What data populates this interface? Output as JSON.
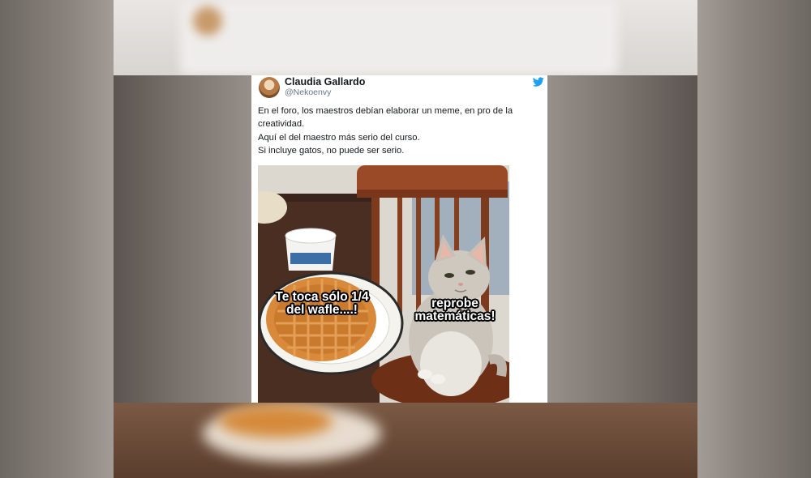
{
  "tweet": {
    "author_name": "Claudia Gallardo",
    "author_handle": "@Nekoenvy",
    "platform_icon": "twitter-bird-icon",
    "lines": [
      "En el foro, los maestros debían elaborar un meme, en pro de la creatividad.",
      "Aquí el del maestro más serio del curso.",
      "Si incluye gatos, no puede ser serio."
    ]
  },
  "meme": {
    "caption_left": "Te toca sólo 1/4 del wafle....!",
    "caption_right": "reprobe matemáticas!"
  },
  "colors": {
    "twitter_blue": "#1da1f2",
    "text_primary": "#14171a",
    "text_secondary": "#657786"
  }
}
